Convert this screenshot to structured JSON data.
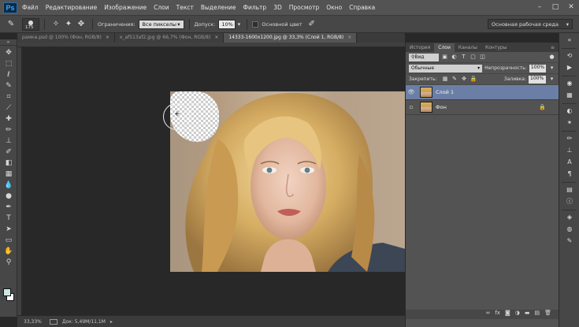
{
  "app": {
    "logo": "Ps"
  },
  "menu": [
    "Файл",
    "Редактирование",
    "Изображение",
    "Слои",
    "Текст",
    "Выделение",
    "Фильтр",
    "3D",
    "Просмотр",
    "Окно",
    "Справка"
  ],
  "options": {
    "brush_size": "175",
    "limit_label": "Ограничения:",
    "limit_value": "Все пикселы",
    "tolerance_label": "Допуск:",
    "tolerance_value": "10%",
    "protect_label": "Основной цвет",
    "workspace": "Основная рабочая среда"
  },
  "doc_tabs": [
    {
      "label": "рамка.psd @ 100% (Фон, RGB/8)",
      "active": false
    },
    {
      "label": "x_af513af2.jpg @ 66,7% (Фон, RGB/8)",
      "active": false
    },
    {
      "label": "14333-1600x1200.jpg @ 33,3% (Слой 1, RGB/8)",
      "active": true
    }
  ],
  "status": {
    "zoom": "33,33%",
    "doc": "Док: 5,49M/11,1M"
  },
  "panel": {
    "tabs": [
      "История",
      "Слои",
      "Каналы",
      "Контуры"
    ],
    "active_tab": "Слои",
    "kind": "Вид",
    "blend": "Обычные",
    "opacity_label": "Непрозрачность:",
    "opacity": "100%",
    "lock_label": "Закрепить:",
    "fill_label": "Заливка:",
    "fill": "100%",
    "layers": [
      {
        "name": "Слой 1",
        "visible": true,
        "selected": true,
        "locked": false
      },
      {
        "name": "Фон",
        "visible": false,
        "selected": false,
        "locked": true
      }
    ]
  },
  "colors": {
    "foreground": "#c9e9e3",
    "background": "#ffffff",
    "selection": "#6b7fa6"
  }
}
